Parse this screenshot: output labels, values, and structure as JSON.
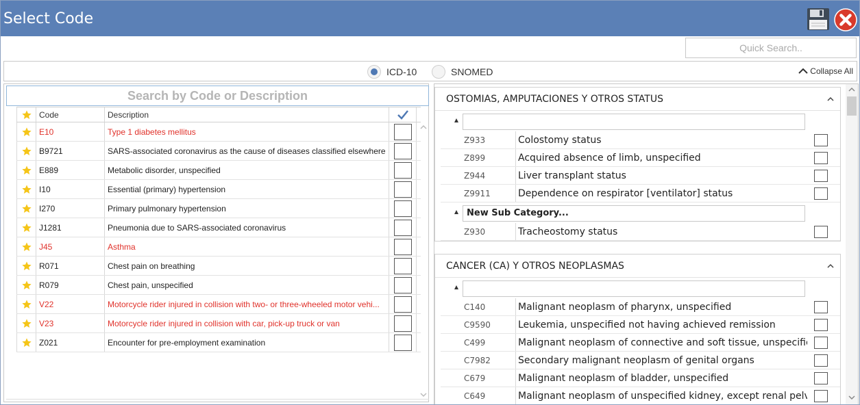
{
  "window": {
    "title": "Select Code"
  },
  "quick_search": {
    "placeholder": "Quick Search.."
  },
  "code_system": {
    "options": [
      "ICD-10",
      "SNOMED"
    ],
    "selected": "ICD-10",
    "collapse_all_label": "Collapse All"
  },
  "favorites": {
    "search_placeholder": "Search by Code or Description",
    "columns": {
      "code": "Code",
      "description": "Description"
    },
    "rows": [
      {
        "code": "E10",
        "description": "Type 1 diabetes mellitus",
        "highlight": true
      },
      {
        "code": "B9721",
        "description": "SARS-associated coronavirus as the cause of diseases classified elsewhere",
        "highlight": false
      },
      {
        "code": "E889",
        "description": "Metabolic disorder, unspecified",
        "highlight": false
      },
      {
        "code": "I10",
        "description": "Essential (primary) hypertension",
        "highlight": false
      },
      {
        "code": "I270",
        "description": "Primary pulmonary hypertension",
        "highlight": false
      },
      {
        "code": "J1281",
        "description": "Pneumonia due to SARS-associated coronavirus",
        "highlight": false
      },
      {
        "code": "J45",
        "description": "Asthma",
        "highlight": true
      },
      {
        "code": "R071",
        "description": "Chest pain on breathing",
        "highlight": false
      },
      {
        "code": "R079",
        "description": "Chest pain, unspecified",
        "highlight": false
      },
      {
        "code": "V22",
        "description": "Motorcycle rider injured in collision with two- or three-wheeled motor vehi...",
        "highlight": true
      },
      {
        "code": "V23",
        "description": "Motorcycle rider injured in collision with car, pick-up truck or van",
        "highlight": true
      },
      {
        "code": "Z021",
        "description": "Encounter for pre-employment examination",
        "highlight": false
      }
    ]
  },
  "categories": [
    {
      "title": "OSTOMIAS, AMPUTACIONES Y OTROS STATUS",
      "subgroups": [
        {
          "name": "",
          "items": [
            {
              "code": "Z933",
              "description": "Colostomy status"
            },
            {
              "code": "Z899",
              "description": "Acquired absence of limb, unspecified"
            },
            {
              "code": "Z944",
              "description": "Liver transplant status"
            },
            {
              "code": "Z9911",
              "description": "Dependence on respirator [ventilator] status"
            }
          ]
        },
        {
          "name": "New Sub Category...",
          "items": [
            {
              "code": "Z930",
              "description": "Tracheostomy status"
            }
          ]
        }
      ]
    },
    {
      "title": "CANCER (CA) Y OTROS NEOPLASMAS",
      "subgroups": [
        {
          "name": "",
          "items": [
            {
              "code": "C140",
              "description": "Malignant neoplasm of pharynx, unspecified"
            },
            {
              "code": "C9590",
              "description": "Leukemia, unspecified not having achieved remission"
            },
            {
              "code": "C499",
              "description": "Malignant neoplasm of connective and soft tissue, unspecified"
            },
            {
              "code": "C7982",
              "description": "Secondary malignant neoplasm of genital organs"
            },
            {
              "code": "C679",
              "description": "Malignant neoplasm of bladder, unspecified"
            },
            {
              "code": "C649",
              "description": "Malignant neoplasm of unspecified kidney, except renal pelvis"
            }
          ]
        }
      ]
    }
  ],
  "colors": {
    "titlebar": "#5b80b6",
    "highlight_text": "#e0312a",
    "star": "#f5c518",
    "check": "#4f79b4"
  }
}
